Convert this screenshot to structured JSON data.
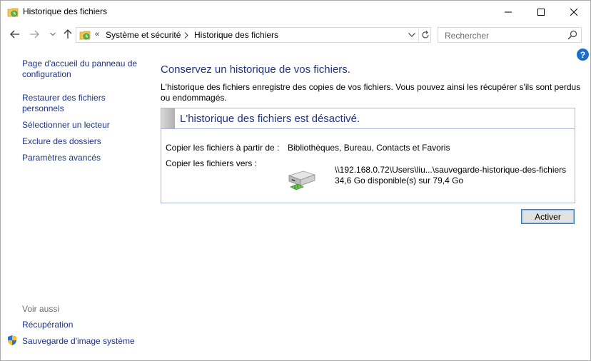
{
  "window": {
    "title": "Historique des fichiers",
    "icon": "file-history-icon"
  },
  "titlebar_buttons": [
    "minimize-icon",
    "maximize-icon",
    "close-icon"
  ],
  "navigation": {
    "back_icon": "back-arrow-icon",
    "forward_icon": "forward-arrow-icon",
    "recent_icon": "chevron-down-icon",
    "up_icon": "up-arrow-icon",
    "address_overflow": "«",
    "breadcrumbs": [
      "Système et sécurité",
      "Historique des fichiers"
    ],
    "search_placeholder": "Rechercher"
  },
  "sidebar": {
    "links": [
      "Page d'accueil du panneau de configuration",
      "Restaurer des fichiers personnels",
      "Sélectionner un lecteur",
      "Exclure des dossiers",
      "Paramètres avancés"
    ],
    "see_also_header": "Voir aussi",
    "see_also": [
      "Récupération",
      "Sauvegarde d'image système"
    ]
  },
  "help_label": "?",
  "main": {
    "title": "Conservez un historique de vos fichiers.",
    "description": "L'historique des fichiers enregistre des copies de vos fichiers. Vous pouvez ainsi les récupérer s'ils sont perdus ou endommagés.",
    "status_panel": {
      "title": "L'historique des fichiers est désactivé.",
      "copy_from_label": "Copier les fichiers à partir de :",
      "copy_from_value": "Bibliothèques, Bureau, Contacts et Favoris",
      "copy_to_label": "Copier les fichiers vers :",
      "drive_path": "\\\\192.168.0.72\\Users\\liu...\\sauvegarde-historique-des-fichiers",
      "drive_space": "34,6 Go disponible(s) sur 79,4 Go"
    },
    "activate_button": "Activer"
  },
  "colors": {
    "link": "#1e3287",
    "heading": "#1e3287",
    "muted": "#6d6d6d",
    "panel_border": "#a8b8d8",
    "button_border": "#3c7fb1"
  }
}
